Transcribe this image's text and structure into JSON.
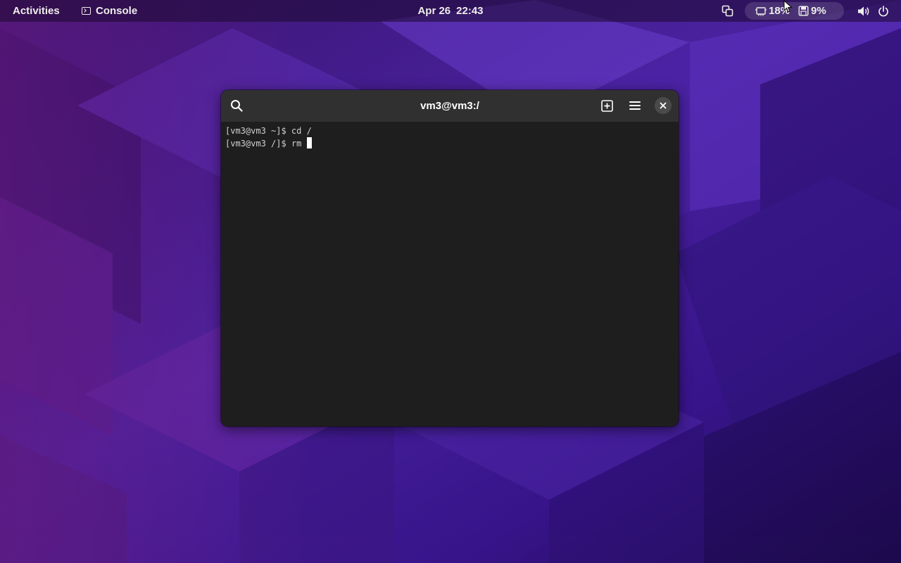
{
  "topbar": {
    "activities_label": "Activities",
    "app_menu_label": "Console",
    "app_menu_icon": "terminal-icon",
    "clock_date": "Apr 26",
    "clock_time": "22:43",
    "system_monitor": {
      "cpu_icon": "cpu-icon",
      "cpu_usage": "18%",
      "memory_icon": "memory-icon",
      "memory_usage": "9%"
    },
    "windows_icon": "window-switcher-icon",
    "volume_icon": "volume-icon",
    "power_icon": "power-icon"
  },
  "terminal": {
    "title": "vm3@vm3:/",
    "search_icon": "search-icon",
    "new_tab_icon": "new-tab-icon",
    "menu_icon": "hamburger-menu-icon",
    "close_icon": "close-icon",
    "lines": [
      "[vm3@vm3 ~]$ cd /",
      "[vm3@vm3 /]$ rm "
    ]
  },
  "colors": {
    "wallpaper_base": "#2b0f58",
    "wallpaper_accent": "#6a34c8",
    "terminal_bg": "#1e1e1e",
    "header_bg": "#303030",
    "topbar_text": "#eeeeec"
  }
}
